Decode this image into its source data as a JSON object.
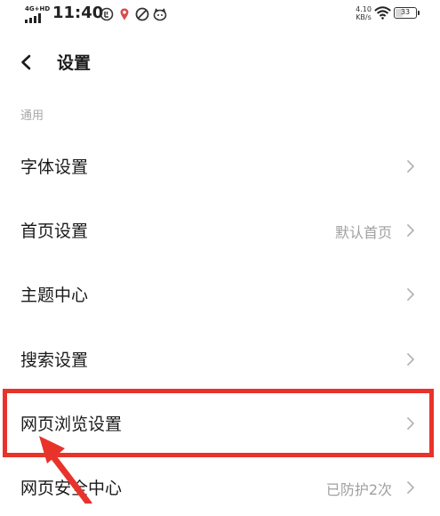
{
  "status_bar": {
    "network": "4G+HD",
    "time": "11:40",
    "net_speed_value": "4.10",
    "net_speed_unit": "KB/s",
    "battery": "33",
    "battery_level": 0.33,
    "icons": [
      "signal-icon",
      "notification-icon",
      "location-pin-icon",
      "app-icon",
      "cat-face-icon",
      "wifi-icon",
      "battery-icon"
    ]
  },
  "header": {
    "title": "设置",
    "back_icon": "chevron-left-icon"
  },
  "section": {
    "label": "通用"
  },
  "items": [
    {
      "label": "字体设置",
      "value": ""
    },
    {
      "label": "首页设置",
      "value": "默认首页"
    },
    {
      "label": "主题中心",
      "value": ""
    },
    {
      "label": "搜索设置",
      "value": ""
    },
    {
      "label": "网页浏览设置",
      "value": ""
    },
    {
      "label": "网页安全中心",
      "value": "已防护2次"
    }
  ],
  "colors": {
    "annotation": "#e8332b",
    "secondary_text": "#a0a0a0",
    "section_label": "#a8a8a8",
    "chevron": "#b5b5b5"
  }
}
